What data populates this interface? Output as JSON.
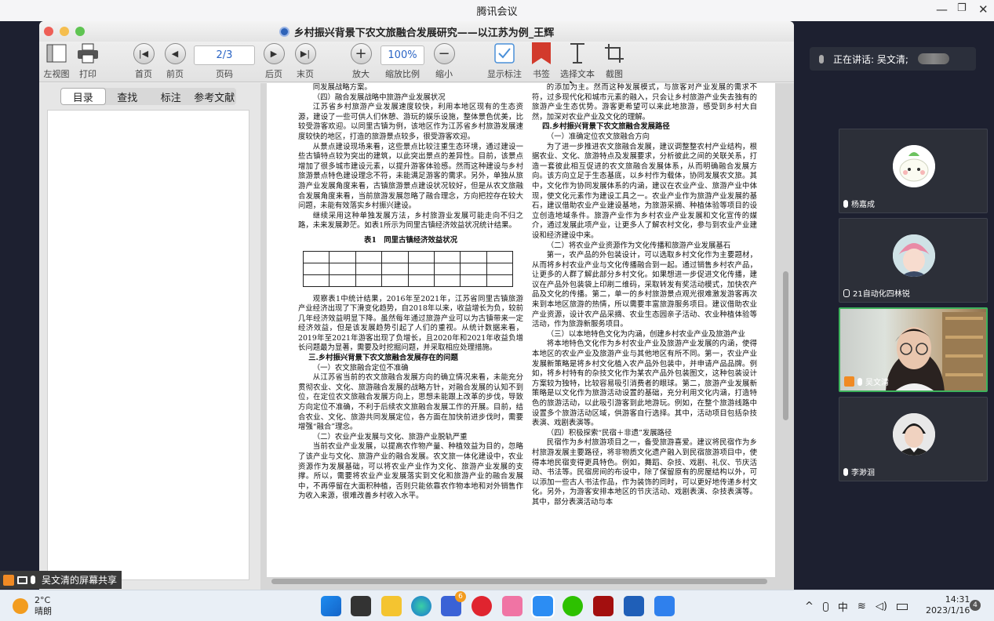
{
  "window": {
    "title": "腾讯会议",
    "controls": [
      "—",
      "❐",
      "✕"
    ]
  },
  "reader": {
    "doc_title": "乡村振兴背景下农文旅融合发展研究——以江苏为例_王辉"
  },
  "toolbar": {
    "items": [
      {
        "label": "左视图",
        "icon": "sidebar-view-icon"
      },
      {
        "label": "打印",
        "icon": "printer-icon"
      },
      {
        "label": "首页",
        "icon": "first-page-icon"
      },
      {
        "label": "前页",
        "icon": "previous-page-icon"
      },
      {
        "label": "页码",
        "icon": "page-number-field"
      },
      {
        "label": "后页",
        "icon": "next-page-icon"
      },
      {
        "label": "末页",
        "icon": "last-page-icon"
      },
      {
        "label": "放大",
        "icon": "zoom-in-icon"
      },
      {
        "label": "缩放比例",
        "icon": "zoom-field"
      },
      {
        "label": "缩小",
        "icon": "zoom-out-icon"
      },
      {
        "label": "显示标注",
        "icon": "checkbox-icon"
      },
      {
        "label": "书签",
        "icon": "bookmark-icon"
      },
      {
        "label": "选择文本",
        "icon": "text-cursor-icon"
      },
      {
        "label": "截图",
        "icon": "crop-icon"
      }
    ],
    "page_value": "2/3",
    "zoom_value": "100%"
  },
  "sidebar": {
    "tabs": [
      "目录",
      "查找",
      "标注",
      "参考文献"
    ],
    "active_tab": "目录"
  },
  "document": {
    "left_column": [
      {
        "k": "p",
        "t": "同发展战略方案。"
      },
      {
        "k": "s",
        "t": "（四）融合发展战略中旅游产业发展状况"
      },
      {
        "k": "p",
        "t": "江苏省乡村旅游产业发展速度较快，利用本地区现有的生态资源，建设了一些可供人们休憩、游玩的娱乐设施，整体景色优美，比较受游客欢迎。以同里古镇为例，该地区作为江苏省乡村旅游发展速度较快的地区，打造的旅游景点较多，很受游客欢迎。"
      },
      {
        "k": "p",
        "t": "从景点建设现场来看，这些景点比较注重生态环境，通过建设一些古镇特点较为突出的建筑，以此突出景点的差异性。目前，该景点增加了很多城市建设元素，以提升游客体验感。然而这种建设与乡村旅游景点特色建设理念不符，未能满足游客的需求。另外，单独从旅游产业发展角度来看，古镇旅游景点建设状况较好，但是从农文旅融合发展角度来看，当前旅游发展忽略了融合理念，方向把控存在较大问题，未能有效落实乡村振兴建设。"
      },
      {
        "k": "p",
        "t": "继续采用这种单独发展方法，乡村旅游业发展可能走向不归之路，未来发展渺茫。如表1所示为同里古镇经济效益状况统计结果。"
      },
      {
        "k": "c",
        "t": "表1　同里古镇经济效益状况"
      },
      {
        "k": "table"
      },
      {
        "k": "p",
        "t": "观察表1中统计结果，2016年至2021年，江苏省同里古镇旅游产业经济出现了下滑变化趋势，自2018年以来，收益增长为负，较前几年经济效益明显下降。虽然每年通过旅游产业可以为古镇带来一定经济效益，但是该发展趋势引起了人们的重视。从统计数据来看，2019年至2021年游客出现了负增长，且2020年和2021年收益负增长问题最为显著，需要及时挖掘问题，并采取相应处理措施。"
      },
      {
        "k": "h",
        "t": "三.乡村振兴背景下农文旅融合发展存在的问题"
      },
      {
        "k": "s",
        "t": "（一）农文旅融合定位不准确"
      },
      {
        "k": "p",
        "t": "从江苏省当前的农文旅融合发展方向的确立情况来看，未能充分贯彻农业、文化、旅游融合发展的战略方针，对融合发展的认知不到位，在定位农文旅融合发展方向上，思想未能跟上改革的步伐，导致方向定位不准确，不利于后续农文旅融合发展工作的开展。目前，结合农业、文化、旅游共同发展定位，各方面在加快前进步伐时，需要增强“融合”理念。"
      },
      {
        "k": "s",
        "t": "（二）农业产业发展与文化、旅游产业脱轨严重"
      },
      {
        "k": "p",
        "t": "当前农业产业发展，以提高农作物产量、种植效益为目的，忽略了该产业与文化、旅游产业的融合发展。农文旅一体化建设中，农业资源作为发展基础，可以将农业产业作为文化、旅游产业发展的支撑。所以，需要将农业产业发展落实到文化和旅游产业的融合发展中，不再停留在大面积种植，否则只能依靠农作物本地和对外销售作为收入来源，很难改善乡村收入水平。"
      }
    ],
    "right_column": [
      {
        "k": "p",
        "t": "的添加为主。然而这种发展模式，与旅客对产业发展的需求不符，过多现代化和城市元素的融入，只会让乡村旅游产业失去独有的旅游产业生态优势。游客更希望可以来此地旅游，感受到乡村大自然，加深对农业产业及文化的理解。"
      },
      {
        "k": "h",
        "t": "四.乡村振兴背景下农文旅融合发展路径"
      },
      {
        "k": "s",
        "t": "（一）准确定位农文旅融合方向"
      },
      {
        "k": "p",
        "t": "为了进一步推进农文旅融合发展，建议调整整农村产业结构，根据农业、文化、旅游特点及发展要求，分析彼此之间的关联关系，打造一套彼此相互促进的农文旅融合发展体系，从而明确融合发展方向。该方向立足于生态基底，以乡村作为载体，协同发展农文旅。其中，文化作为协同发展体系的内涵，建议在农业产业、旅游产业中体现，使文化元素作为建设工具之一。农业产业作为旅游产业发展的基石，建议借助农业产业建设基地，为旅游采摘、种植体验等项目的设立创造地域条件。旅游产业作为乡村农业产业发展和文化宣传的媒介，通过发展此项产业，让更多人了解农村文化，参与到农业产业建设和经济建设中来。"
      },
      {
        "k": "s",
        "t": "（二）将农业产业资源作为文化传播和旅游产业发展基石"
      },
      {
        "k": "p",
        "t": "第一，农产品的外包装设计，可以选取乡村文化作为主要题材，从而将乡村农业产业与文化传播融合到一起。通过销售乡村农产品，让更多的人群了解此部分乡村文化。如果想进一步促进文化传播，建议在产品外包装袋上印刷二维码，采取转发有奖活动模式，加快农产品及文化的传播。第二，单一的乡村旅游景点观光很难激发游客再次来到本地区旅游的热情，所以需要丰富旅游服务项目。建议借助农业产业资源，设计农产品采摘、农业生态园亲子活动、农业种植体验等活动，作为旅游新服务项目。"
      },
      {
        "k": "s",
        "t": "（三）以本地特色文化为内涵，创建乡村农业产业及旅游产业"
      },
      {
        "k": "p",
        "t": "将本地特色文化作为乡村农业产业及旅游产业发展的内涵，使得本地区的农业产业及旅游产业与其他地区有所不同。第一，农业产业发展新策略是将乡村文化植入农产品外包装中，并申请产品品牌。例如，将乡村特有的杂技文化作为某农产品外包装图文，这种包装设计方案较为独特，比较容易吸引消费者的眼球。第二，旅游产业发展新策略是以文化作为旅游活动设置的基础，充分利用文化内涵，打造特色的旅游活动，以此吸引游客到此地游玩。例如，在整个旅游线路中设置多个旅游活动区域，供游客自行选择。其中，活动项目包括杂技表演、戏剧表演等。"
      },
      {
        "k": "s",
        "t": "（四）积极探索“民宿＋非遗”发展路径"
      },
      {
        "k": "p",
        "t": "民宿作为乡村旅游项目之一，备受旅游喜爱。建议将民宿作为乡村旅游发展主要路径，将非物质文化遗产融入到民宿旅游项目中，使得本地民宿变得更具特色。例如，舞蹈、杂技、戏剧、礼仪、节庆活动、书法等。民宿房间的布设中，除了保留原有的房屋结构以外，可以添加一些古人书法作品，作为装饰的同时，可以更好地传递乡村文化。另外，为游客安排本地区的节庆活动、戏剧表演、杂技表演等。其中，部分表演活动与本"
      }
    ]
  },
  "share_bar": {
    "label": "吴文清的屏幕共享"
  },
  "meeting": {
    "speaking": "正在讲话: 吴文清;",
    "participants": [
      {
        "name": "杨嘉成"
      },
      {
        "name": "21自动化四林锐"
      },
      {
        "name": "吴文清"
      },
      {
        "name": "李渺洄"
      }
    ]
  },
  "taskbar": {
    "weather_temp": "2°C",
    "weather_desc": "晴朗",
    "time": "14:31",
    "date": "2023/1/16",
    "notif_count": "4",
    "ime": "中",
    "badge": "6"
  }
}
